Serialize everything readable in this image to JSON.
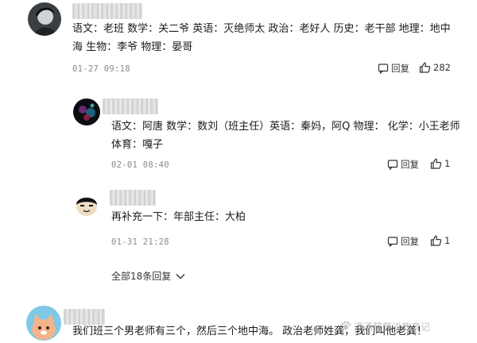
{
  "comments": [
    {
      "text_line1": "语文：老班  数学：关二爷  英语：灭绝师太  政治：老好人  历史：老干部  地理：地中",
      "text_line2": "海  生物：李爷  物理：晏哥",
      "time": "01-27  09:18",
      "reply_label": "回复",
      "likes": "282"
    },
    {
      "text_line1": "语文：阿唐  数学：数刘（班主任）英语：秦妈，阿Q  物理：   化学：小王老师",
      "text_line2": "体育：嘎子",
      "time": "02-01  08:40",
      "reply_label": "回复",
      "likes": "1"
    },
    {
      "text_line1": "再补充一下：年部主任：大柏",
      "time": "01-31  21:28",
      "reply_label": "回复",
      "likes": "1"
    },
    {
      "text_line1": "我们班三个男老师有三个，然后三个地中海。 政治老师姓龚，我们叫他老龚！"
    }
  ],
  "expand_replies": "全部18条回复",
  "watermark": "酒酒慧馨说教育记",
  "icons": {
    "reply": "reply-bubble-icon",
    "like": "thumbs-up-icon",
    "expand": "chevron-down-icon",
    "watermark": "paw-logo-icon"
  },
  "colors": {
    "text": "#1a1a1a",
    "meta": "#8a8a8a",
    "background": "#ffffff"
  }
}
